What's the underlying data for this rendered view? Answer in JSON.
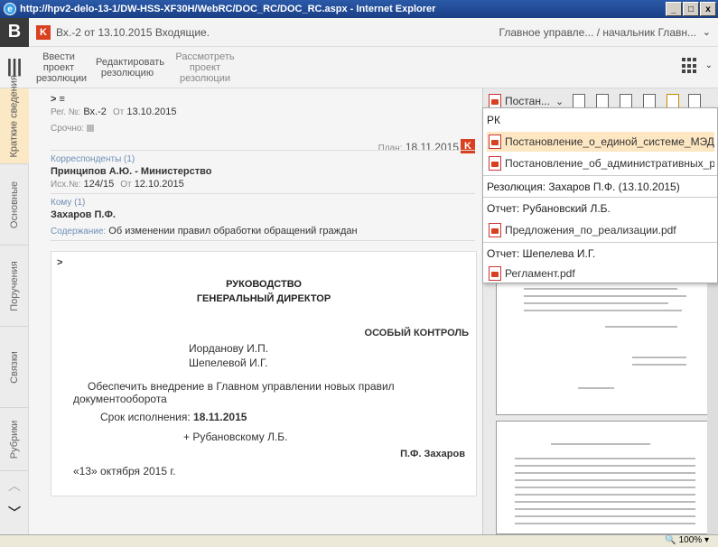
{
  "window": {
    "title": "http://hpv2-delo-13-1/DW-HSS-XF30H/WebRC/DOC_RC/DOC_RC.aspx - Internet Explorer",
    "buttons": [
      "_",
      "□",
      "x"
    ]
  },
  "header": {
    "logo": "B",
    "badge": "K",
    "doc_title": "Вх.-2 от 13.10.2015  Входящие.",
    "user": "Главное управле... / начальник Главн...",
    "chevron": "⌄"
  },
  "toolbar": {
    "menu_icon": "≡",
    "buttons": [
      {
        "label": "Ввести проект резолюции"
      },
      {
        "label": "Редактировать резолюцию"
      },
      {
        "label": "Рассмотреть проект резолюции"
      }
    ]
  },
  "sidebar": {
    "tabs": [
      "Краткие сведения",
      "Основные",
      "Поручения",
      "Связки",
      "Рубрики"
    ]
  },
  "card": {
    "toggle": "> ≡",
    "reg_label": "Рег. №:",
    "reg_value": "Вх.-2",
    "date_label": "От",
    "date_value": "13.10.2015",
    "urgent_label": "Срочно:",
    "plan_label": "План:",
    "plan_value": "18.11.2015",
    "plan_badge": "K",
    "corr_label": "Корреспонденты (1)",
    "corr_value": "Принципов А.Ю. - Министерство",
    "out_label": "Исх.№:",
    "out_value": "124/15",
    "out_date_label": "От",
    "out_date_value": "12.10.2015",
    "to_label": "Кому (1)",
    "to_value": "Захаров П.Ф.",
    "content_label": "Содержание:",
    "content_value": "Об изменении правил обработки обращений граждан"
  },
  "resolution": {
    "chevron": ">",
    "heading1": "РУКОВОДСТВО",
    "heading2": "ГЕНЕРАЛЬНЫЙ ДИРЕКТОР",
    "control": "ОСОБЫЙ КОНТРОЛЬ",
    "addressee1": "Иорданову И.П.",
    "addressee2": "Шепелевой И.Г.",
    "text_line1": "Обеспечить внедрение в Главном управлении новых правил",
    "text_line2": "документооборота",
    "deadline_label": "Срок исполнения:",
    "deadline_value": "18.11.2015",
    "copy_to": "+ Рубановскому Л.Б.",
    "signer": "П.Ф. Захаров",
    "date": "«13» октября 2015 г."
  },
  "right_toolbar": {
    "dropdown_label": "Постан...",
    "chevron": "⌄"
  },
  "dropdown": {
    "items": [
      {
        "type": "header",
        "text": "РК"
      },
      {
        "type": "file",
        "text": "Постановление_о_единой_системе_МЭДО.pdf",
        "highlight": true
      },
      {
        "type": "file",
        "text": "Постановление_об_административных_реглам"
      },
      {
        "type": "header",
        "text": "Резолюция: Захаров П.Ф. (13.10.2015)"
      },
      {
        "type": "header",
        "text": "Отчет: Рубановский Л.Б."
      },
      {
        "type": "file",
        "text": "Предложения_по_реализации.pdf"
      },
      {
        "type": "header",
        "text": "Отчет: Шепелева И.Г."
      },
      {
        "type": "file",
        "text": "Регламент.pdf"
      }
    ]
  },
  "statusbar": {
    "zoom": "100%"
  },
  "colors": {
    "accent": "#d9401f",
    "highlight": "#fde7c2",
    "active_tab": "#fbe8c4"
  }
}
